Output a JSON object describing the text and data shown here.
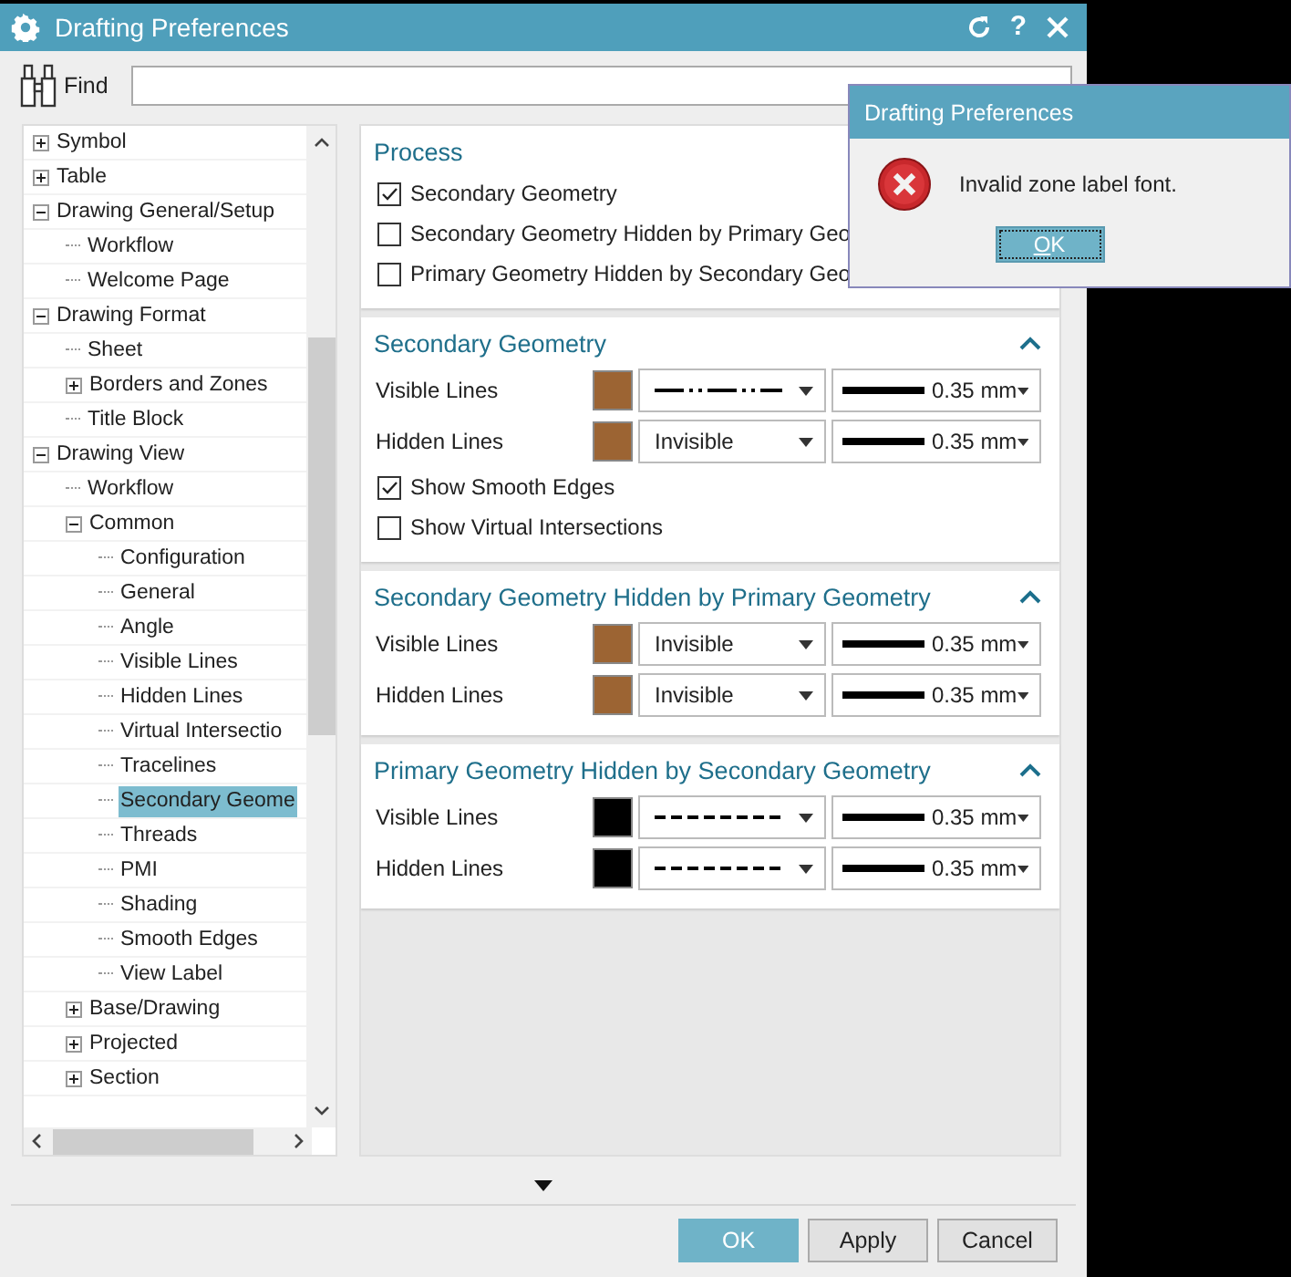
{
  "window": {
    "title": "Drafting Preferences",
    "help": "?"
  },
  "find": {
    "label": "Find"
  },
  "tree": {
    "items": [
      {
        "label": "Symbol",
        "expanded": false,
        "selected": false
      },
      {
        "label": "Table",
        "expanded": false,
        "selected": false
      },
      {
        "label": "Drawing General/Setup",
        "expanded": true,
        "selected": false,
        "children": [
          {
            "label": "Workflow",
            "selected": false
          },
          {
            "label": "Welcome Page",
            "selected": false
          }
        ]
      },
      {
        "label": "Drawing Format",
        "expanded": true,
        "selected": false,
        "children": [
          {
            "label": "Sheet",
            "selected": false
          },
          {
            "label": "Borders and Zones",
            "expanded": false,
            "selected": false
          },
          {
            "label": "Title Block",
            "selected": false
          }
        ]
      },
      {
        "label": "Drawing View",
        "expanded": true,
        "selected": false,
        "children": [
          {
            "label": "Workflow",
            "selected": false
          },
          {
            "label": "Common",
            "expanded": true,
            "selected": false,
            "children": [
              {
                "label": "Configuration",
                "selected": false
              },
              {
                "label": "General",
                "selected": false
              },
              {
                "label": "Angle",
                "selected": false
              },
              {
                "label": "Visible Lines",
                "selected": false
              },
              {
                "label": "Hidden Lines",
                "selected": false
              },
              {
                "label": "Virtual Intersectio",
                "selected": false
              },
              {
                "label": "Tracelines",
                "selected": false
              },
              {
                "label": "Secondary Geome",
                "selected": true
              },
              {
                "label": "Threads",
                "selected": false
              },
              {
                "label": "PMI",
                "selected": false
              },
              {
                "label": "Shading",
                "selected": false
              },
              {
                "label": "Smooth Edges",
                "selected": false
              },
              {
                "label": "View Label",
                "selected": false
              }
            ]
          },
          {
            "label": "Base/Drawing",
            "expanded": false,
            "selected": false
          },
          {
            "label": "Projected",
            "expanded": false,
            "selected": false
          },
          {
            "label": "Section",
            "expanded": false,
            "selected": false
          }
        ]
      }
    ]
  },
  "process": {
    "title": "Process",
    "options": [
      {
        "label": "Secondary Geometry",
        "checked": true
      },
      {
        "label": "Secondary Geometry Hidden by Primary Geo",
        "checked": false
      },
      {
        "label": "Primary Geometry Hidden by Secondary Geo",
        "checked": false
      }
    ]
  },
  "sections": [
    {
      "title": "Secondary Geometry",
      "expanded": true,
      "rows": [
        {
          "label": "Visible Lines",
          "color": "#9c6433",
          "line_style": {
            "kind": "dash-dot"
          },
          "line_width": "0.35 mm"
        },
        {
          "label": "Hidden Lines",
          "color": "#9c6433",
          "line_style": {
            "kind": "text",
            "text": "Invisible"
          },
          "line_width": "0.35 mm"
        }
      ],
      "options": [
        {
          "label": "Show Smooth Edges",
          "checked": true
        },
        {
          "label": "Show Virtual Intersections",
          "checked": false
        }
      ]
    },
    {
      "title": "Secondary Geometry Hidden by Primary Geometry",
      "expanded": true,
      "rows": [
        {
          "label": "Visible Lines",
          "color": "#9c6433",
          "line_style": {
            "kind": "text",
            "text": "Invisible"
          },
          "line_width": "0.35 mm"
        },
        {
          "label": "Hidden Lines",
          "color": "#9c6433",
          "line_style": {
            "kind": "text",
            "text": "Invisible"
          },
          "line_width": "0.35 mm"
        }
      ]
    },
    {
      "title": "Primary Geometry Hidden by Secondary Geometry",
      "expanded": true,
      "rows": [
        {
          "label": "Visible Lines",
          "color": "#000000",
          "line_style": {
            "kind": "dashed"
          },
          "line_width": "0.35 mm"
        },
        {
          "label": "Hidden Lines",
          "color": "#000000",
          "line_style": {
            "kind": "dashed"
          },
          "line_width": "0.35 mm"
        }
      ]
    }
  ],
  "buttons": [
    {
      "label": "OK",
      "default": true
    },
    {
      "label": "Apply",
      "default": false
    },
    {
      "label": "Cancel",
      "default": false
    }
  ],
  "message_box": {
    "title": "Drafting Preferences",
    "message": "Invalid zone label font.",
    "button": "OK"
  }
}
